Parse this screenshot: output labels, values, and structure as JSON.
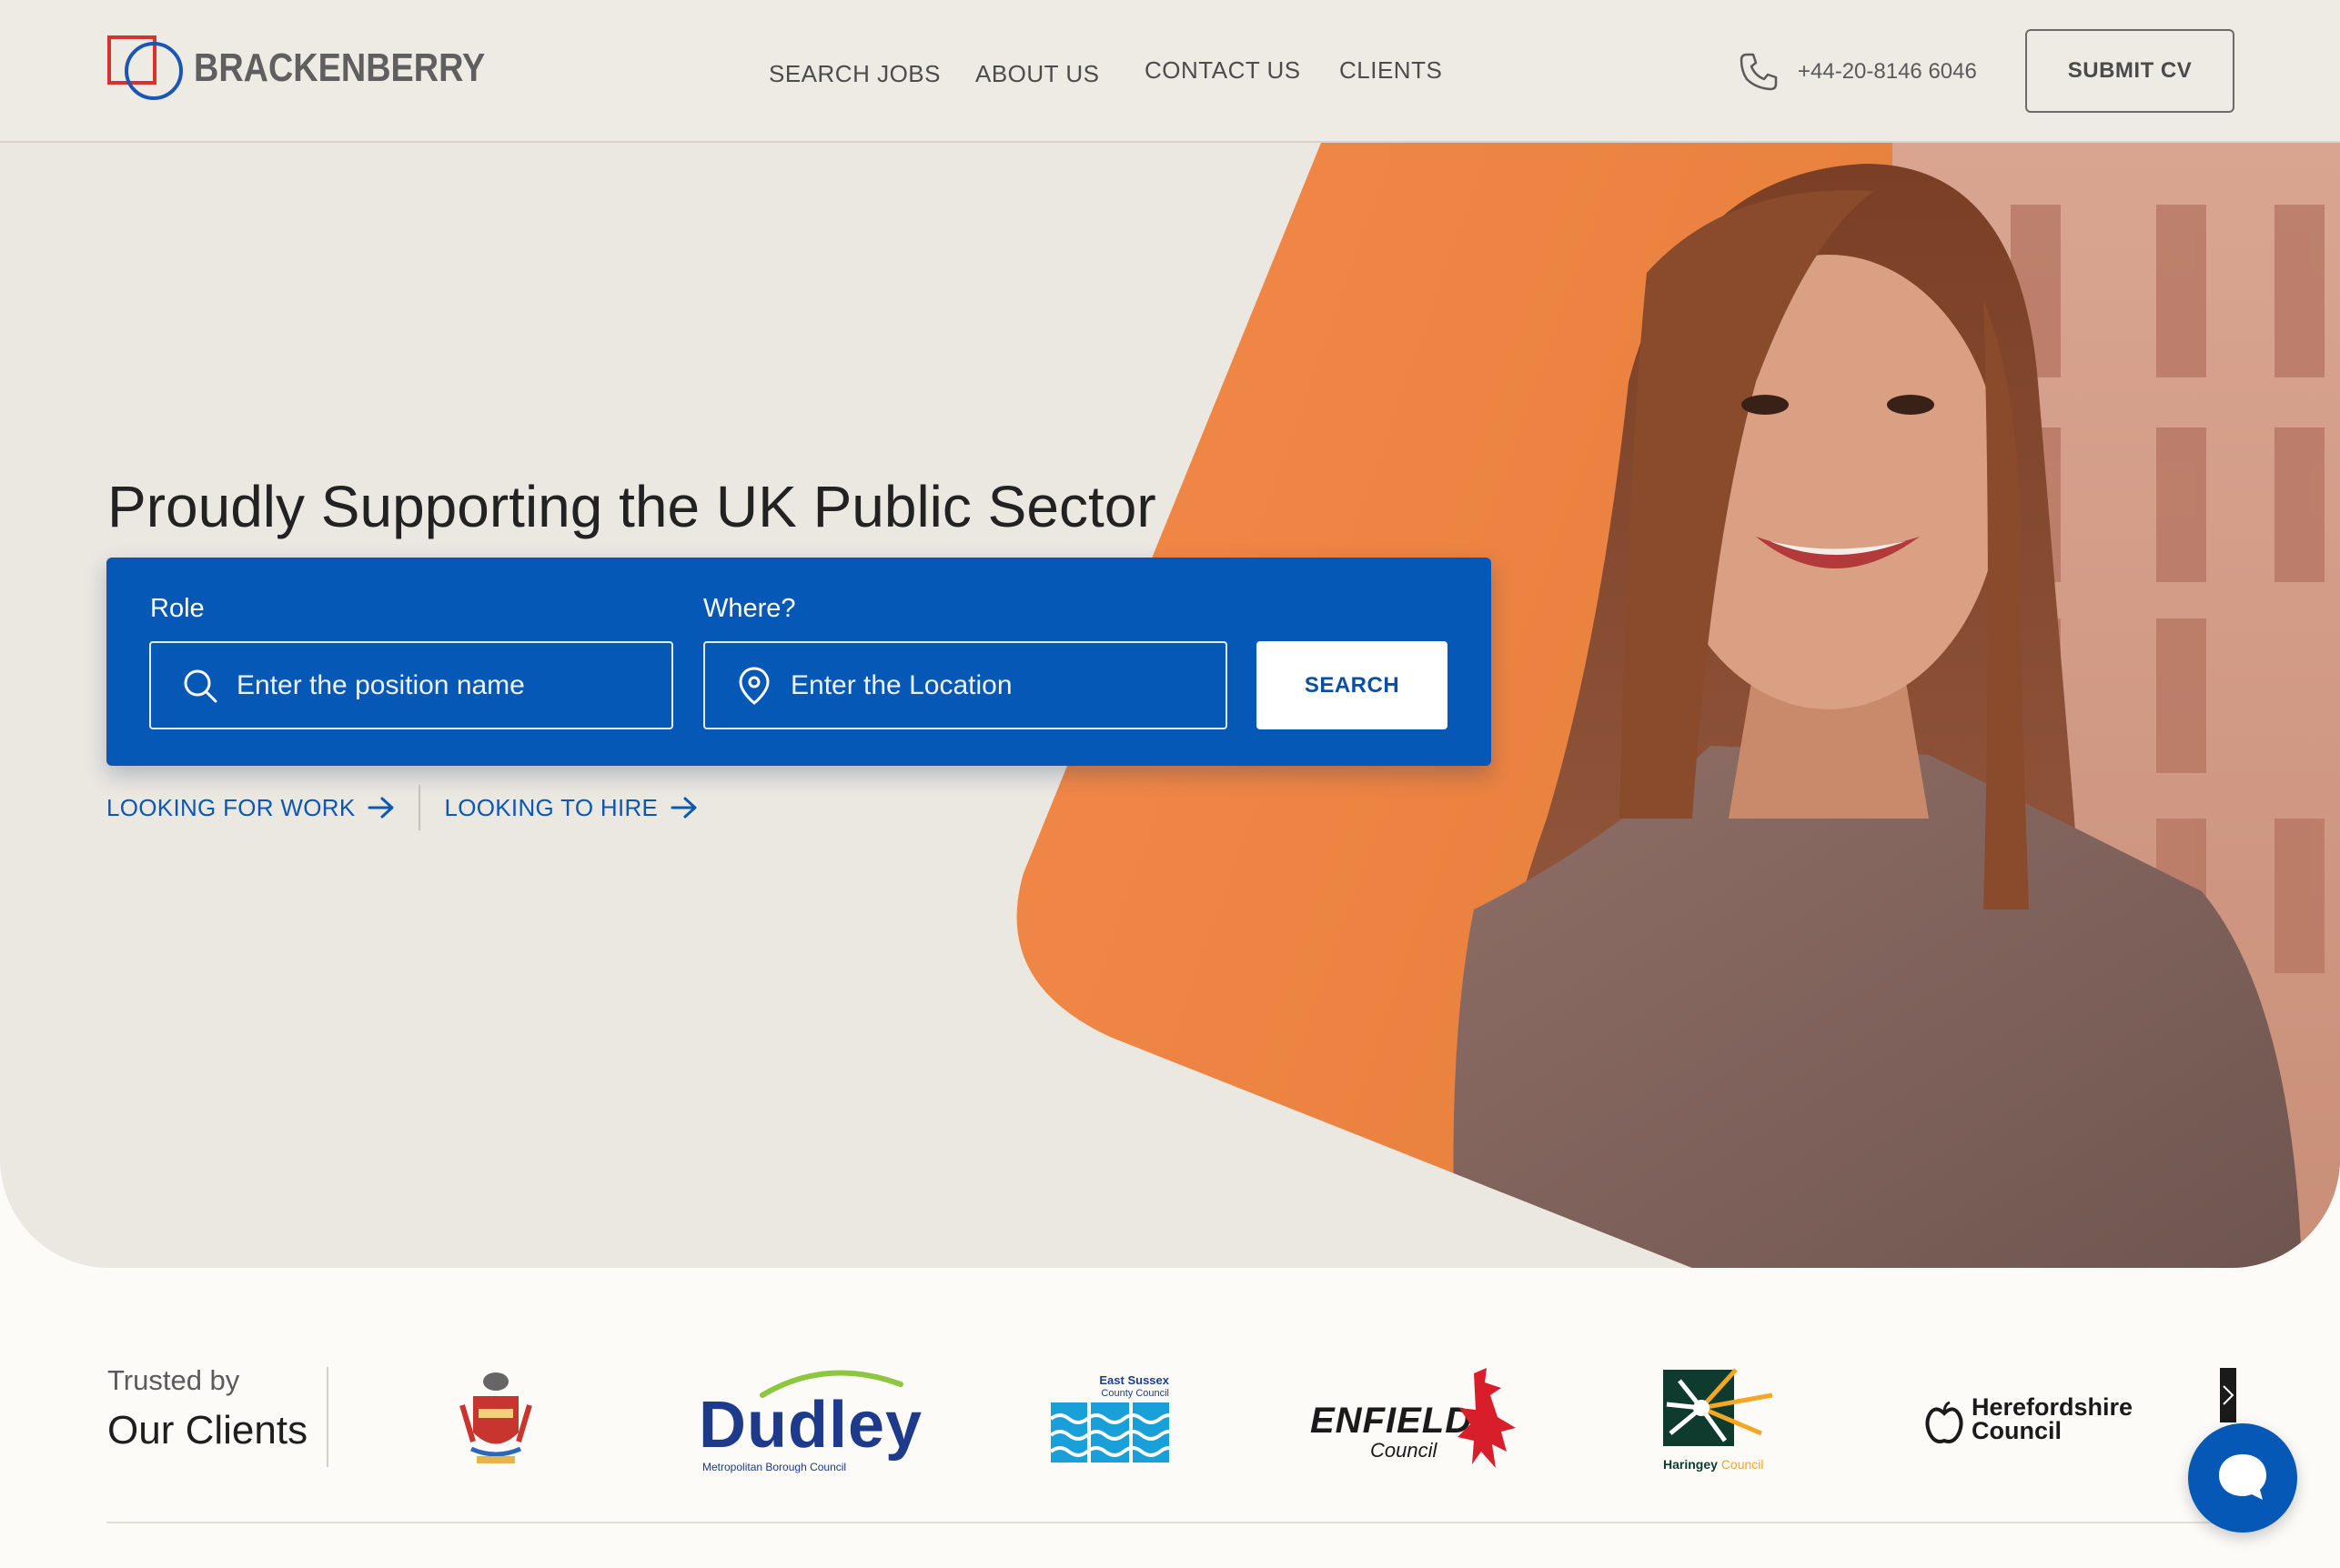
{
  "brand": {
    "name": "BRACKENBERRY"
  },
  "nav": {
    "items": [
      {
        "label": "SEARCH JOBS"
      },
      {
        "label": "ABOUT US"
      },
      {
        "label": "CONTACT US"
      },
      {
        "label": "CLIENTS"
      }
    ],
    "phone": "+44-20-8146 6046",
    "submit_cv": "SUBMIT CV"
  },
  "hero": {
    "headline": "Proudly Supporting the UK Public Sector",
    "search": {
      "role_label": "Role",
      "role_placeholder": "Enter the position name",
      "where_label": "Where?",
      "where_placeholder": "Enter the Location",
      "button": "SEARCH"
    },
    "links": {
      "work": "LOOKING FOR WORK",
      "hire": "LOOKING TO HIRE"
    }
  },
  "clients": {
    "trusted_by": "Trusted by",
    "our_clients": "Our Clients",
    "logos": {
      "dudley": "Dudley",
      "dudley_sub": "Metropolitan Borough Council",
      "east_sussex_1": "East Sussex",
      "east_sussex_2": "County Council",
      "enfield": "ENFIELD",
      "enfield_sub": "Council",
      "haringey": "Haringey",
      "haringey_sub": "Council",
      "hereford_1": "Herefordshire",
      "hereford_2": "Council"
    }
  },
  "colors": {
    "primary_blue": "#0558b5",
    "orange_accent": "#f0823e",
    "hero_bg": "#ebe8e2"
  }
}
